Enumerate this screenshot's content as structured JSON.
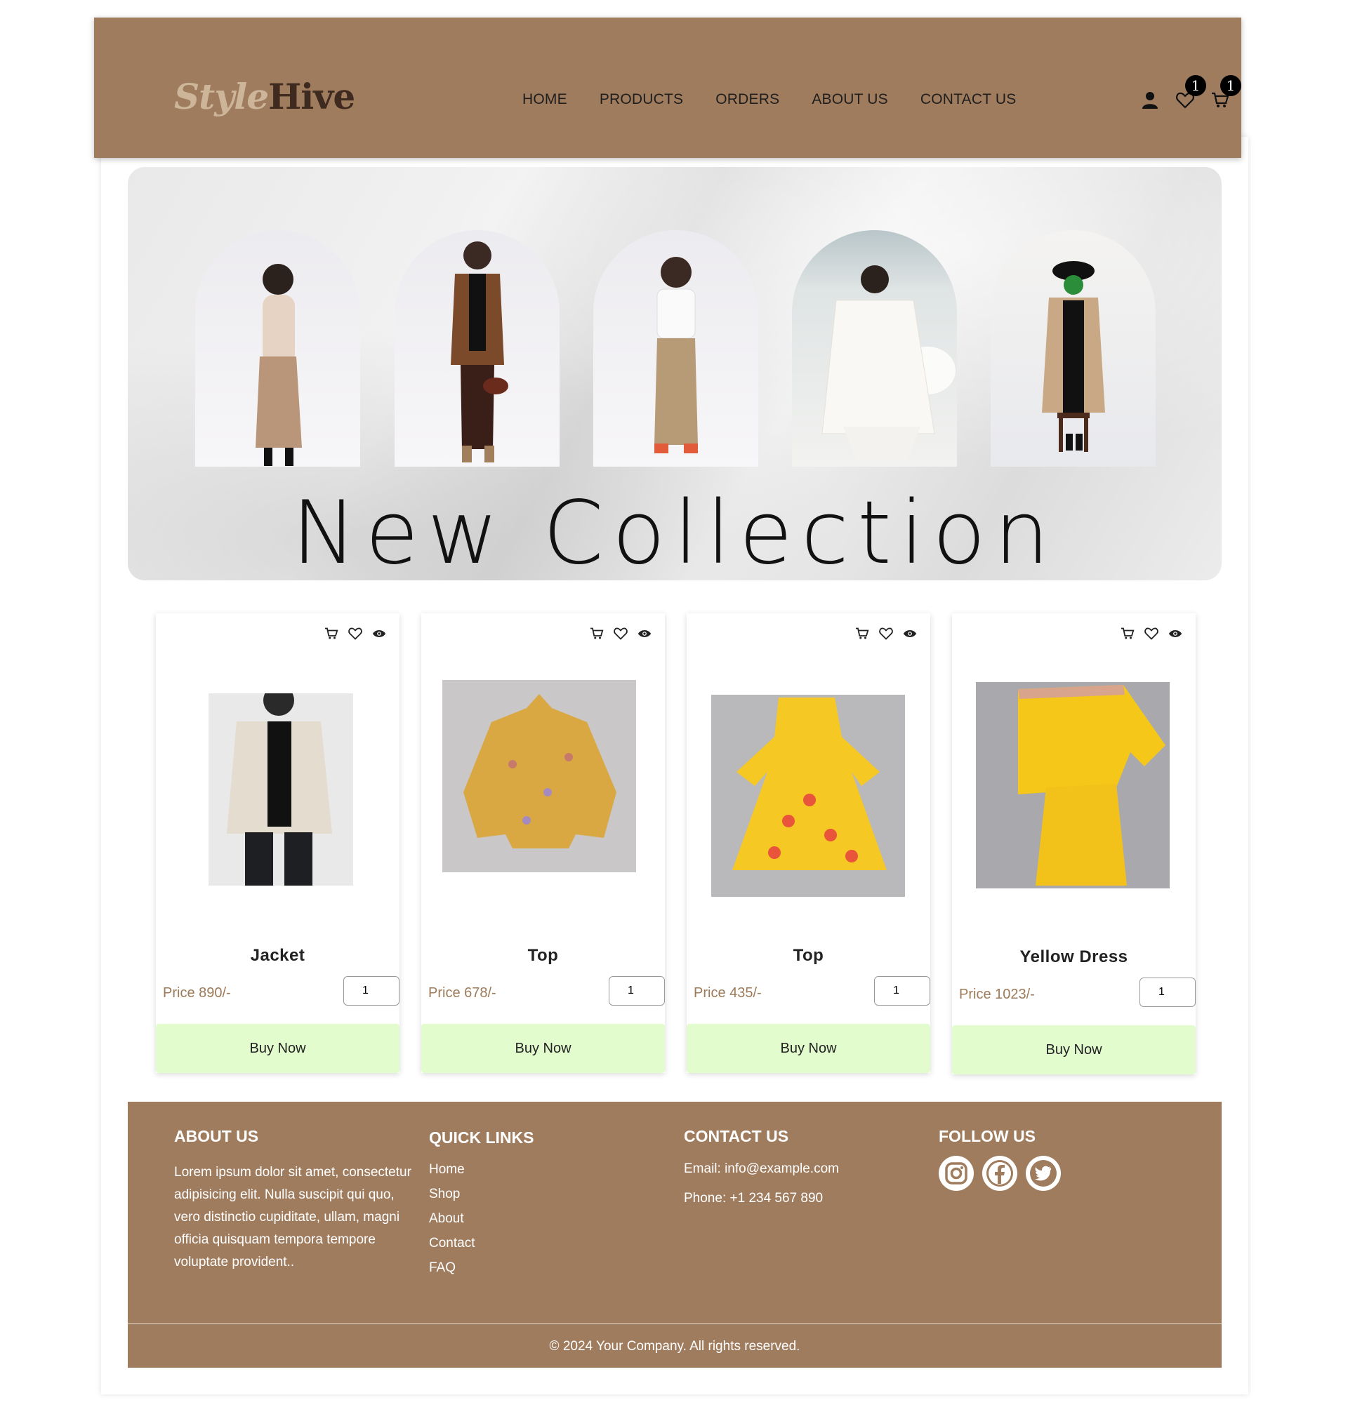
{
  "header": {
    "logo_part1": "Style",
    "logo_part2": "Hive",
    "nav": [
      "HOME",
      "PRODUCTS",
      "ORDERS",
      "ABOUT US",
      "CONTACT US"
    ],
    "wishlist_count": "1",
    "cart_count": "1"
  },
  "hero": {
    "title": "New Collection"
  },
  "products": [
    {
      "name": "Jacket",
      "price": "Price 890/-",
      "qty": "1",
      "buy": "Buy Now"
    },
    {
      "name": "Top",
      "price": "Price 678/-",
      "qty": "1",
      "buy": "Buy Now"
    },
    {
      "name": "Top",
      "price": "Price 435/-",
      "qty": "1",
      "buy": "Buy Now"
    },
    {
      "name": "Yellow Dress",
      "price": "Price 1023/-",
      "qty": "1",
      "buy": "Buy Now"
    }
  ],
  "footer": {
    "about_title": "ABOUT US",
    "about_text": "Lorem ipsum dolor sit amet, consectetur adipisicing elit. Nulla suscipit qui quo, vero distinctio cupiditate, ullam, magni officia quisquam tempora tempore voluptate provident..",
    "links_title": "QUICK LINKS",
    "links": [
      "Home",
      "Shop",
      "About",
      "Contact",
      "FAQ"
    ],
    "contact_title": "CONTACT US",
    "email": "Email: info@example.com",
    "phone": "Phone: +1 234 567 890",
    "follow_title": "FOLLOW US",
    "copyright": "© 2024 Your Company. All rights reserved."
  },
  "colors": {
    "brand_brown": "#a07c5f",
    "buy_button": "#e3fcce",
    "price_text": "#9d7a59"
  },
  "icons": [
    "user-icon",
    "heart-icon",
    "cart-icon",
    "eye-icon",
    "instagram-icon",
    "facebook-icon",
    "twitter-icon"
  ]
}
